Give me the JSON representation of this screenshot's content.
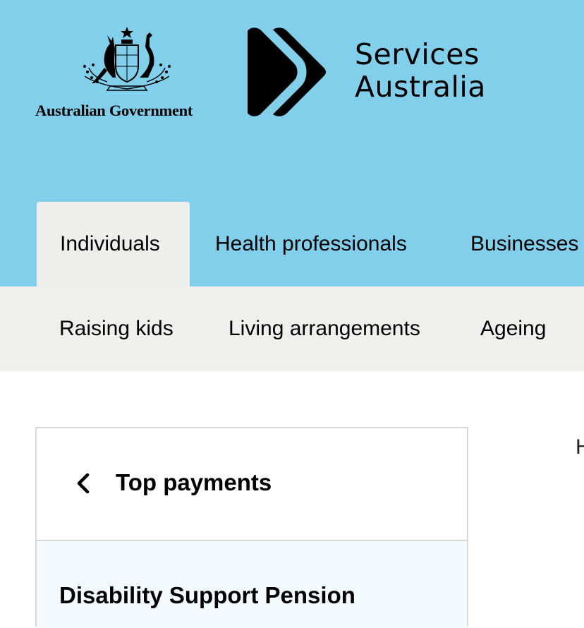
{
  "header": {
    "gov_name": "Australian Government",
    "agency_name_line1": "Services",
    "agency_name_line2": "Australia",
    "background": "#81cfeb"
  },
  "audience_tabs": [
    {
      "label": "Individuals",
      "active": true
    },
    {
      "label": "Health professionals",
      "active": false
    },
    {
      "label": "Businesses",
      "active": false
    }
  ],
  "subnav": [
    {
      "label": "Raising kids"
    },
    {
      "label": "Living arrangements"
    },
    {
      "label": "Ageing"
    }
  ],
  "side_menu": {
    "back_icon": "chevron-left-icon",
    "title": "Top payments",
    "current_item": "Disability Support Pension"
  },
  "content": {
    "clipped_text": "H"
  }
}
